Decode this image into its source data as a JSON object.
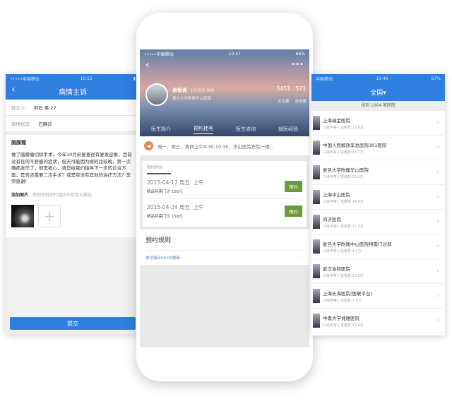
{
  "left": {
    "status": {
      "carrier": "•••••中国移动",
      "time": "10:52"
    },
    "title": "病情主诉",
    "patient_label": "就诊人:",
    "patient_value": "何石  男  27",
    "state_label": "病情状态:",
    "state_value": "已确诊",
    "disease": "脑膜瘤",
    "description": "做了脑膜瘤切除手术，今年10月份复查说有复发迹象，目前没有任何不舒服的症状，但天可能因为嫁的比较晚，第一次确病发作了，很是担心，请您给我们指导下一步的诊治方案，是否还需要二次手术？或是有没有其他的治疗方法？非常感谢!",
    "add_image": "添加图片",
    "add_image_hint": "病例资料图片相应的信息及报告",
    "submit": "提交",
    "accent": "#2f7fe0"
  },
  "mid": {
    "status": {
      "carrier": "•••••中国移动",
      "time": "10:47",
      "battery": "66%"
    },
    "doctor": {
      "name": "俞智勇",
      "title": "主任医师 教授",
      "hospital": "复旦大学附属华山医院"
    },
    "stats": [
      {
        "value": "3451",
        "label": "关注量"
      },
      {
        "value": "571",
        "label": "咨询量"
      }
    ],
    "tabs": [
      "医生简介",
      "预约挂号",
      "医生咨询",
      "就医经验"
    ],
    "notice": "周一、周三，周四上午9.30-10.30，华山医院东院一楼...",
    "card_title": "预约时间",
    "slots": [
      {
        "date": "2015-04-17 周五",
        "period": "上午",
        "fee": "精品特需门诊  158元",
        "button": "预约"
      },
      {
        "date": "2015-04-24 周五",
        "period": "上午",
        "fee": "精品特需门诊  158元",
        "button": "预约"
      }
    ],
    "rules_title": "预约规则",
    "rules_sub": "放号每日00:00更新",
    "button_color": "#6a9a3a"
  },
  "right": {
    "status": {
      "carrier": "中国移动",
      "time": "10:46",
      "battery": "67%"
    },
    "title": "全国▾",
    "found": "找到 1064 家医院",
    "hospitals": [
      {
        "name": "上海瑞金医院",
        "sub": "三级甲等 | 患者数:13.9万"
      },
      {
        "name": "中国人民解放军总医院301医院",
        "sub": "三级甲等 | 患者数:34.7万"
      },
      {
        "name": "复旦大学附属华山医院",
        "sub": "三级甲等 | 患者数:30.3万"
      },
      {
        "name": "上海中山医院",
        "sub": "三级甲等 | 患者数:14.8万"
      },
      {
        "name": "同济医院",
        "sub": "三级甲等 | 患者数:11.4万"
      },
      {
        "name": "复旦大学附属中山医院特需门诊部",
        "sub": "三级甲等 | 患者数:4.2万"
      },
      {
        "name": "武汉协和医院",
        "sub": "三级甲等 | 患者数:10.2万"
      },
      {
        "name": "上海长海医院(医联平台)",
        "sub": "三级甲等 | 患者数:3.9万"
      },
      {
        "name": "中南大学湘雅医院",
        "sub": "三级甲等 | 患者数:33.8万"
      }
    ]
  }
}
